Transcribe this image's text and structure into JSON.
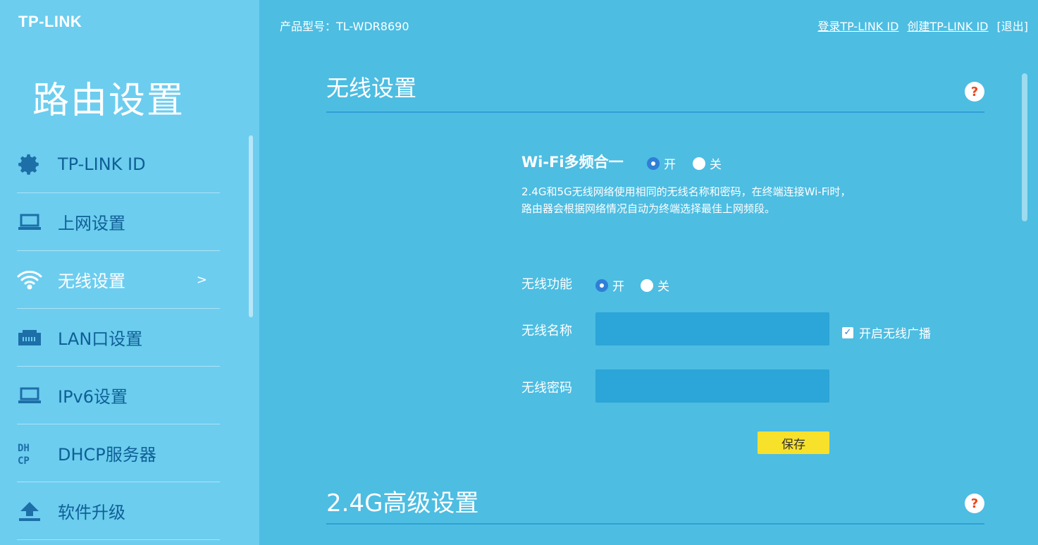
{
  "brand": "TP-LINK",
  "sidebar": {
    "title": "路由设置",
    "items": [
      {
        "label": "TP-LINK ID",
        "icon": "gear-icon"
      },
      {
        "label": "上网设置",
        "icon": "laptop-icon"
      },
      {
        "label": "无线设置",
        "icon": "wifi-icon",
        "active": true
      },
      {
        "label": "LAN口设置",
        "icon": "lan-port-icon"
      },
      {
        "label": "IPv6设置",
        "icon": "laptop-icon"
      },
      {
        "label": "DHCP服务器",
        "icon": "dhcp-icon"
      },
      {
        "label": "软件升级",
        "icon": "upload-icon"
      }
    ],
    "active_arrow": ">"
  },
  "header": {
    "model": "产品型号：TL-WDR8690",
    "login_link": "登录TP-LINK ID",
    "create_link": "创建TP-LINK ID",
    "logout": "[退出]"
  },
  "wireless": {
    "title": "无线设置",
    "help": "?",
    "multiband_label": "Wi-Fi多频合一",
    "multiband_on": "开",
    "multiband_off": "关",
    "desc_line1": "2.4G和5G无线网络使用相同的无线名称和密码，在终端连接Wi-Fi时，",
    "desc_line2": "路由器会根据网络情况自动为终端选择最佳上网频段。",
    "func_label": "无线功能",
    "func_on": "开",
    "func_off": "关",
    "ssid_label": "无线名称",
    "ssid_value": "",
    "broadcast_label": "开启无线广播",
    "password_label": "无线密码",
    "password_value": "",
    "save_label": "保存"
  },
  "advanced_24g": {
    "title": "2.4G高级设置",
    "help": "?"
  },
  "colors": {
    "main_bg": "#4dbde2",
    "sidebar_bg": "#6ccdef",
    "save_btn": "#f8e12b",
    "input_bg": "#2ca5d8"
  }
}
